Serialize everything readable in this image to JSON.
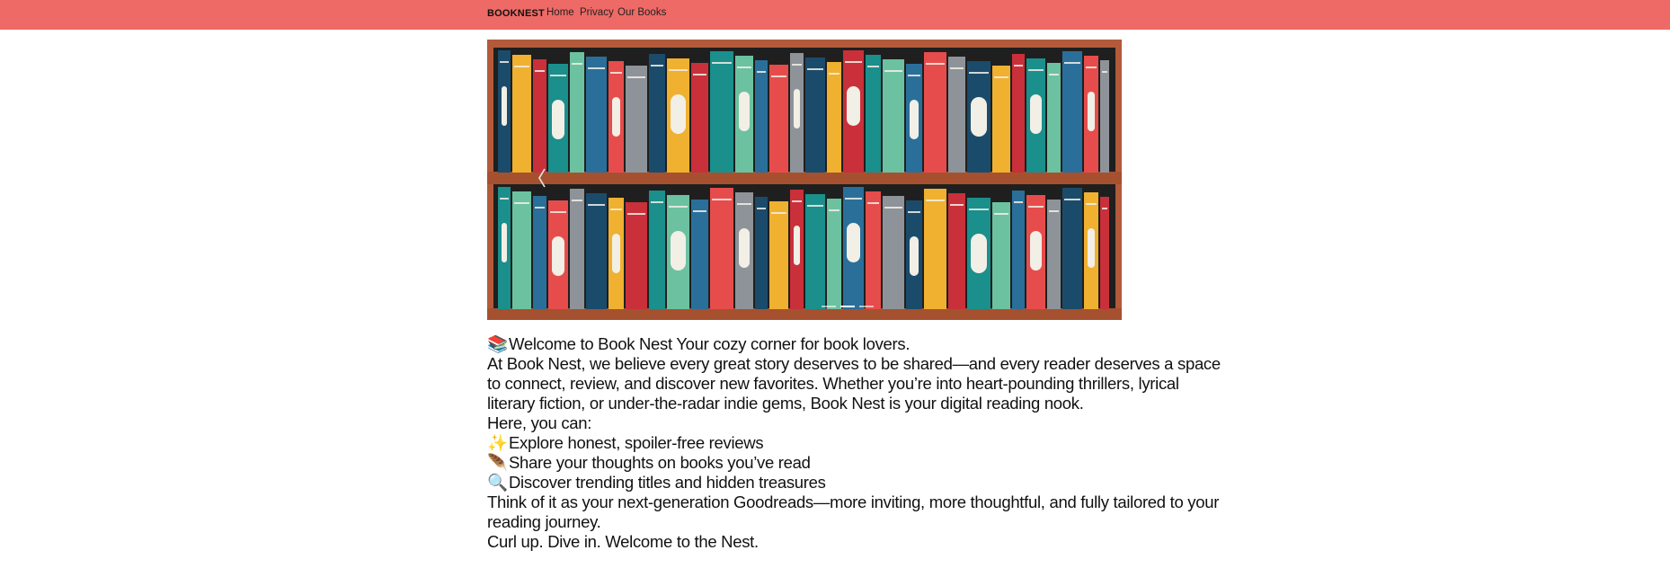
{
  "nav": {
    "brand": "BOOKNEST",
    "links": [
      "Home",
      "Privacy",
      "Our Books"
    ],
    "bg_color": "#ee6a66"
  },
  "carousel": {
    "prev_icon": "chevron-left-icon",
    "indicator_count": 3,
    "active_indicator": 1,
    "image_subject": "bookshelf-illustration"
  },
  "content": {
    "intro_emoji": "📚",
    "intro": "Welcome to Book Nest Your cozy corner for book lovers.",
    "paragraph": "At Book Nest, we believe every great story deserves to be shared—and every reader deserves a space to connect, review, and discover new favorites. Whether you’re into heart-pounding thrillers, lyrical literary fiction, or under-the-radar indie gems, Book Nest is your digital reading nook.",
    "here_label": "Here, you can:",
    "bullets": [
      {
        "emoji": "✨",
        "text": "Explore honest, spoiler-free reviews"
      },
      {
        "emoji": "🪶",
        "text": "Share your thoughts on books you’ve read"
      },
      {
        "emoji": "🔍",
        "text": "Discover trending titles and hidden treasures"
      }
    ],
    "closing": "Think of it as your next-generation Goodreads—more inviting, more thoughtful, and fully tailored to your reading journey.",
    "signoff": "Curl up. Dive in. Welcome to the Nest."
  }
}
